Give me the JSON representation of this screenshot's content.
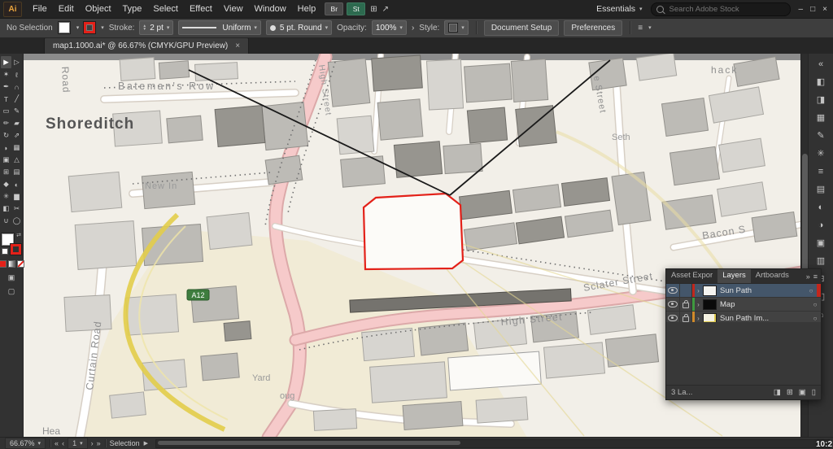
{
  "colors": {
    "accent_red": "#e32119",
    "selected_layer_blue": "#44566a",
    "sun_path_yellow": "#e2cd4a",
    "badge_green": "#3e7d3e"
  },
  "menu_bar": {
    "logo": "Ai",
    "items": [
      "File",
      "Edit",
      "Object",
      "Type",
      "Select",
      "Effect",
      "View",
      "Window",
      "Help"
    ],
    "bridge_button": "Br",
    "stock_button": "St",
    "arrange_icon": "⊞",
    "gpu_icon": "↗",
    "workspace": "Essentials",
    "workspace_caret": "▾",
    "search_placeholder": "Search Adobe Stock",
    "minimize": "–",
    "restore": "□",
    "close": "×"
  },
  "control_bar": {
    "no_selection": "No Selection",
    "stroke_label": "Stroke:",
    "stroke_value": "2 pt",
    "width_profile": "Uniform",
    "brush": "5 pt. Round",
    "opacity_label": "Opacity:",
    "opacity_value": "100%",
    "opacity_chevron": "›",
    "style_label": "Style:",
    "document_setup": "Document Setup",
    "preferences": "Preferences",
    "menu_icon": "≡",
    "caret": "▾",
    "step_up": "▴",
    "step_down": "▾"
  },
  "tab": {
    "title": "map1.1000.ai* @ 66.67% (CMYK/GPU Preview)",
    "close": "×"
  },
  "tools": [
    {
      "name": "selection",
      "glyph": "▶"
    },
    {
      "name": "direct-selection",
      "glyph": "▷"
    },
    {
      "name": "magic-wand",
      "glyph": "✶"
    },
    {
      "name": "lasso",
      "glyph": "ℓ"
    },
    {
      "name": "pen",
      "glyph": "✒"
    },
    {
      "name": "curvature",
      "glyph": "∩"
    },
    {
      "name": "type",
      "glyph": "T"
    },
    {
      "name": "line-segment",
      "glyph": "╱"
    },
    {
      "name": "rectangle",
      "glyph": "▭"
    },
    {
      "name": "paintbrush",
      "glyph": "✎"
    },
    {
      "name": "pencil",
      "glyph": "✏"
    },
    {
      "name": "eraser",
      "glyph": "▰"
    },
    {
      "name": "rotate",
      "glyph": "↻"
    },
    {
      "name": "scale",
      "glyph": "⇗"
    },
    {
      "name": "width",
      "glyph": "◗"
    },
    {
      "name": "free-transform",
      "glyph": "▦"
    },
    {
      "name": "shape-builder",
      "glyph": "▣"
    },
    {
      "name": "perspective-grid",
      "glyph": "△"
    },
    {
      "name": "mesh",
      "glyph": "⊞"
    },
    {
      "name": "gradient",
      "glyph": "▤"
    },
    {
      "name": "eyedropper",
      "glyph": "◆"
    },
    {
      "name": "blend",
      "glyph": "◐"
    },
    {
      "name": "symbol-sprayer",
      "glyph": "✳"
    },
    {
      "name": "column-graph",
      "glyph": "▆"
    },
    {
      "name": "artboard",
      "glyph": "◧"
    },
    {
      "name": "slice",
      "glyph": "✂"
    },
    {
      "name": "hand",
      "glyph": "∪"
    },
    {
      "name": "zoom",
      "glyph": "◯"
    }
  ],
  "dock_icons": [
    {
      "name": "collapse-panels",
      "glyph": "«"
    },
    {
      "name": "color",
      "glyph": "◧"
    },
    {
      "name": "color-guide",
      "glyph": "◨"
    },
    {
      "name": "swatches",
      "glyph": "▦"
    },
    {
      "name": "brushes",
      "glyph": "✎"
    },
    {
      "name": "symbols",
      "glyph": "✳"
    },
    {
      "name": "stroke",
      "glyph": "≡"
    },
    {
      "name": "gradient",
      "glyph": "▤"
    },
    {
      "name": "transparency",
      "glyph": "◐"
    },
    {
      "name": "appearance",
      "glyph": "◑"
    },
    {
      "name": "graphic-styles",
      "glyph": "▣"
    },
    {
      "name": "layers",
      "glyph": "▥"
    },
    {
      "name": "artboards",
      "glyph": "⊞"
    },
    {
      "name": "asset-export",
      "glyph": "◫"
    },
    {
      "name": "libraries",
      "glyph": "⌂"
    }
  ],
  "layers_panel": {
    "tabs": [
      "Asset Expor",
      "Layers",
      "Artboards"
    ],
    "expand_icon": "»",
    "menu_icon": "≡",
    "disclosure": "›",
    "target": "○",
    "layers": [
      {
        "name": "Sun Path"
      },
      {
        "name": "Map"
      },
      {
        "name": "Sun Path Im..."
      }
    ],
    "footer": "3 La...",
    "footer_icons": {
      "mask": "◨",
      "sublayer": "⊞",
      "new_layer": "▣",
      "trash": "▯"
    }
  },
  "status_bar": {
    "zoom": "66.67%",
    "zoom_caret": "▾",
    "nav_first": "«",
    "nav_prev": "‹",
    "artboard": "1",
    "artboard_caret": "▾",
    "nav_next": "›",
    "nav_last": "»",
    "tool": "Selection",
    "tool_arrow": "▶"
  },
  "map": {
    "labels": {
      "shoreditch": "Shoreditch",
      "batemans_row": "Bateman's Row",
      "new_inn": "New In",
      "sclater_street": "Sclater Street",
      "bacon_street": "Bacon S",
      "high_street": "High Street",
      "high_street_vertical": "High Street",
      "curtain_road": "Curtain Road",
      "yard": "Yard",
      "road": "Road",
      "hea": "Hea",
      "oug": "oug",
      "e_street": "e Street",
      "seth": "Seth",
      "hack": "hack"
    },
    "badge_a12": "A12"
  },
  "overlay": {
    "timestamp": "10:2"
  }
}
